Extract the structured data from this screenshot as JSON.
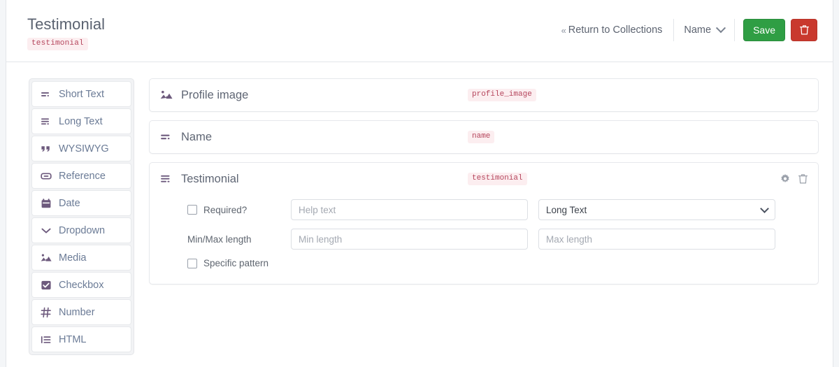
{
  "header": {
    "title": "Testimonial",
    "slug": "testimonial",
    "return_link": "Return to Collections",
    "return_chevron": "«",
    "sort_select_value": "Name",
    "save_label": "Save",
    "delete_icon": "trash-icon"
  },
  "palette": {
    "items": [
      {
        "label": "Short Text",
        "icon": "short-text-icon"
      },
      {
        "label": "Long Text",
        "icon": "long-text-icon"
      },
      {
        "label": "WYSIWYG",
        "icon": "quote-icon"
      },
      {
        "label": "Reference",
        "icon": "link-icon"
      },
      {
        "label": "Date",
        "icon": "calendar-icon"
      },
      {
        "label": "Dropdown",
        "icon": "chevron-down-icon"
      },
      {
        "label": "Media",
        "icon": "image-icon"
      },
      {
        "label": "Checkbox",
        "icon": "checkbox-icon"
      },
      {
        "label": "Number",
        "icon": "hash-icon"
      },
      {
        "label": "HTML",
        "icon": "list-icon"
      }
    ]
  },
  "fields": [
    {
      "label": "Profile image",
      "slug": "profile_image",
      "icon": "image-icon",
      "expanded": false
    },
    {
      "label": "Name",
      "slug": "name",
      "icon": "short-text-icon",
      "expanded": false
    },
    {
      "label": "Testimonial",
      "slug": "testimonial",
      "icon": "long-text-icon",
      "expanded": true
    }
  ],
  "field_settings": {
    "required_label": "Required?",
    "required_checked": false,
    "help_text_value": "",
    "help_text_placeholder": "Help text",
    "type_value": "Long Text",
    "type_options": [
      "Long Text"
    ],
    "minmax_label": "Min/Max length",
    "min_value": "",
    "min_placeholder": "Min length",
    "max_value": "",
    "max_placeholder": "Max length",
    "pattern_label": "Specific pattern",
    "pattern_checked": false,
    "gear_icon": "gear-icon",
    "trash_icon": "trash-icon"
  },
  "colors": {
    "accent_save": "#2f9e44",
    "accent_delete": "#c9392e",
    "slug_bg": "#fceef0",
    "slug_fg": "#b5455c",
    "icon_purple": "#6d5a7d",
    "palette_text": "#6b7b96"
  }
}
